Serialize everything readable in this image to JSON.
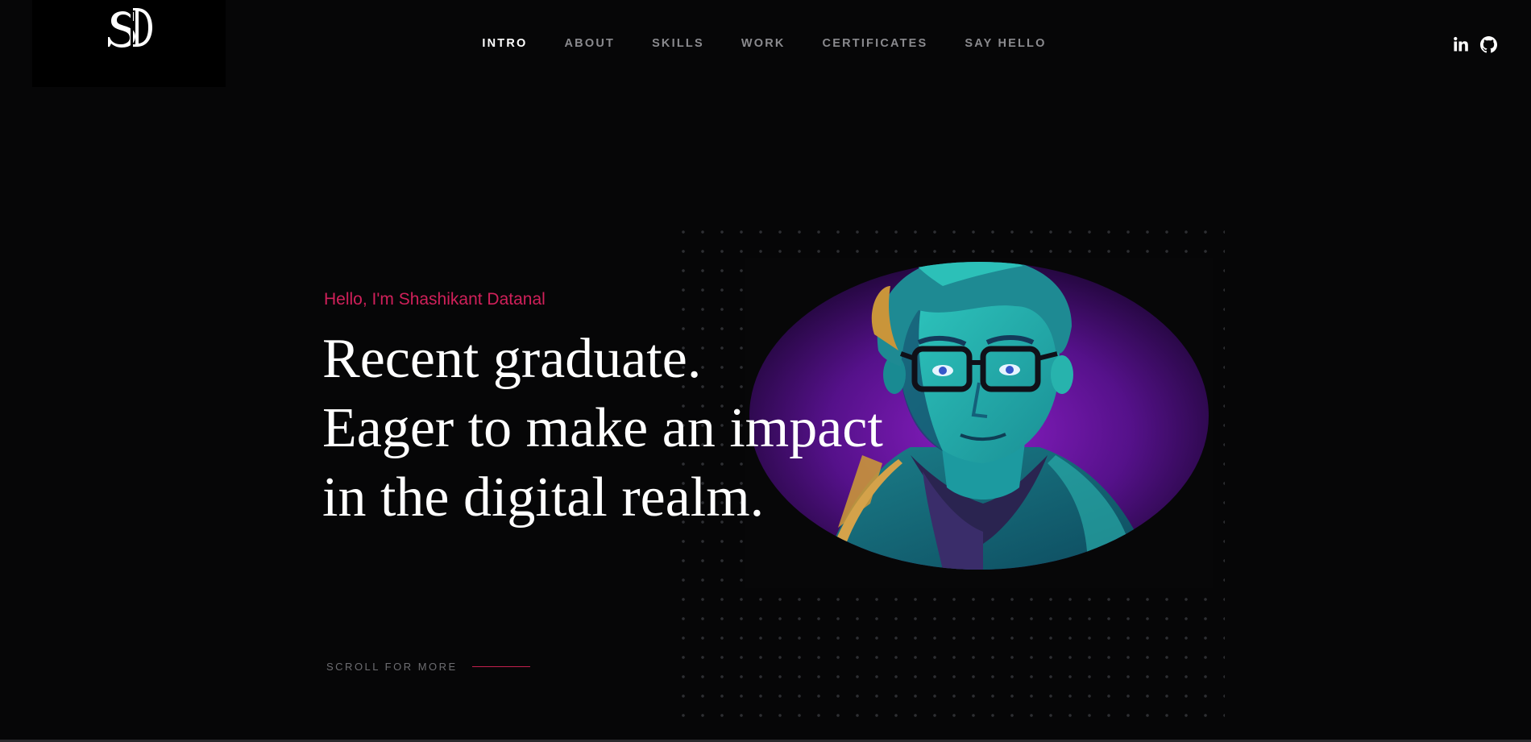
{
  "brand": {
    "logo_text": "SD"
  },
  "nav": {
    "items": [
      {
        "label": "INTRO",
        "active": true
      },
      {
        "label": "ABOUT",
        "active": false
      },
      {
        "label": "SKILLS",
        "active": false
      },
      {
        "label": "WORK",
        "active": false
      },
      {
        "label": "CERTIFICATES",
        "active": false
      },
      {
        "label": "SAY HELLO",
        "active": false
      }
    ]
  },
  "social": {
    "linkedin_icon": "linkedin-icon",
    "github_icon": "github-icon"
  },
  "hero": {
    "greeting": "Hello, I'm Shashikant Datanal",
    "headline_lines": [
      "Recent graduate.",
      "Eager to make an impact",
      "in the digital realm."
    ],
    "scroll_label": "SCROLL FOR MORE"
  },
  "colors": {
    "background": "#060607",
    "accent": "#d0205a",
    "nav_inactive": "#8a8a8e",
    "nav_active": "#ffffff",
    "portrait_purple": "#5a0f8c",
    "portrait_teal": "#1aa3a0"
  }
}
